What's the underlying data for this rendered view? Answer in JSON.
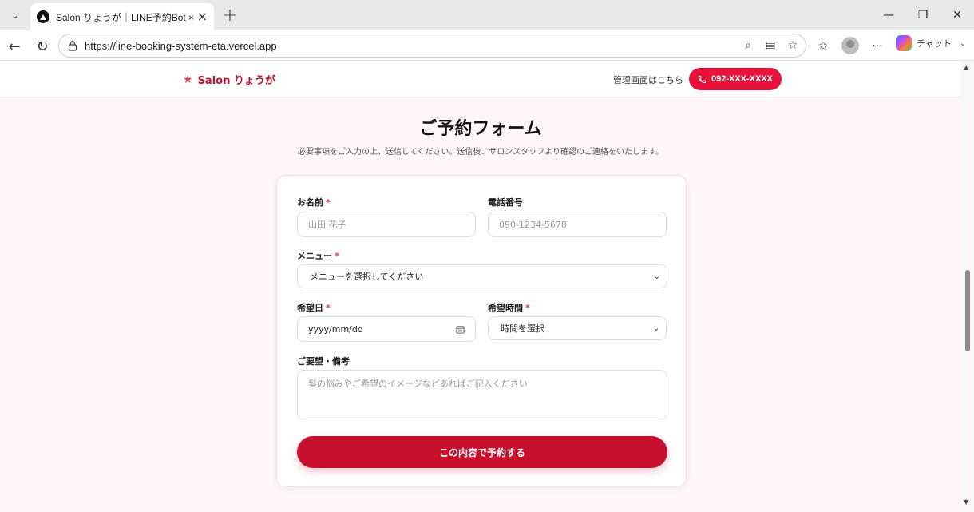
{
  "browser": {
    "tab_title": "Salon りょうが｜LINE予約Bot × Slack",
    "url": "https://line-booking-system-eta.vercel.app",
    "copilot_label": "チャット"
  },
  "header": {
    "brand_name": "Salon りょうが",
    "admin_link": "管理画面はこちら",
    "phone_label": "092-XXX-XXXX"
  },
  "page": {
    "title": "ご予約フォーム",
    "subtitle": "必要事項をご入力の上、送信してください。送信後、サロンスタッフより確認のご連絡をいたします。"
  },
  "form": {
    "name": {
      "label": "お名前",
      "required_mark": "*",
      "placeholder": "山田 花子"
    },
    "phone": {
      "label": "電話番号",
      "placeholder": "090-1234-5678"
    },
    "menu": {
      "label": "メニュー",
      "required_mark": "*",
      "value": "メニューを選択してください"
    },
    "date": {
      "label": "希望日",
      "required_mark": "*",
      "value": "yyyy/mm/dd"
    },
    "time": {
      "label": "希望時間",
      "required_mark": "*",
      "value": "時間を選択"
    },
    "notes": {
      "label": "ご要望・備考",
      "placeholder": "髪の悩みやご希望のイメージなどあればご記入ください"
    },
    "submit_label": "この内容で予約する"
  },
  "colors": {
    "brand": "#c4102f",
    "phone_button": "#e8123a",
    "submit_button": "#c8102e",
    "page_bg": "#fff6f7"
  }
}
